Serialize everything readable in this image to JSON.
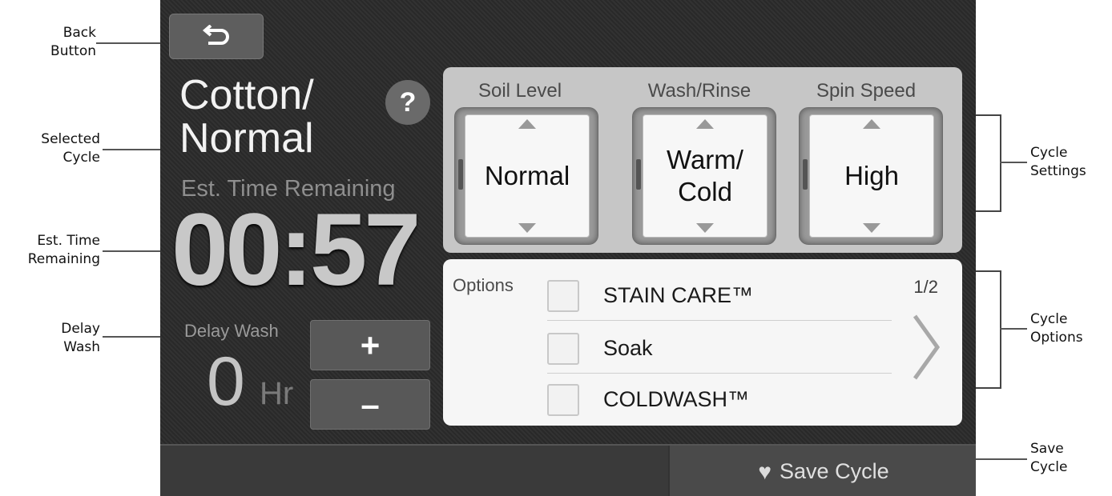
{
  "callouts": {
    "back": "Back\nButton",
    "selected_cycle": "Selected\nCycle",
    "est_time": "Est. Time\nRemaining",
    "delay_wash": "Delay\nWash",
    "cycle_settings": "Cycle\nSettings",
    "cycle_options": "Cycle\nOptions",
    "save_cycle": "Save\nCycle"
  },
  "screen": {
    "cycle_name": "Cotton/\nNormal",
    "help_label": "?",
    "est_time_label": "Est. Time Remaining",
    "est_time_value": "00:57",
    "delay_label": "Delay Wash",
    "delay_value": "0",
    "delay_unit": "Hr",
    "plus_label": "+",
    "minus_label": "–"
  },
  "settings": [
    {
      "title": "Soil Level",
      "value": "Normal"
    },
    {
      "title": "Wash/Rinse",
      "value": "Warm/\nCold"
    },
    {
      "title": "Spin Speed",
      "value": "High"
    }
  ],
  "options": {
    "title": "Options",
    "page": "1/2",
    "items": [
      {
        "label": "STAIN CARE™"
      },
      {
        "label": "Soak"
      },
      {
        "label": "COLDWASH™"
      }
    ]
  },
  "save": {
    "label": "Save Cycle"
  },
  "icons": {
    "back": "back-arrow-icon",
    "help": "question-icon",
    "next": "chevron-right-icon",
    "save": "heart-icon"
  }
}
